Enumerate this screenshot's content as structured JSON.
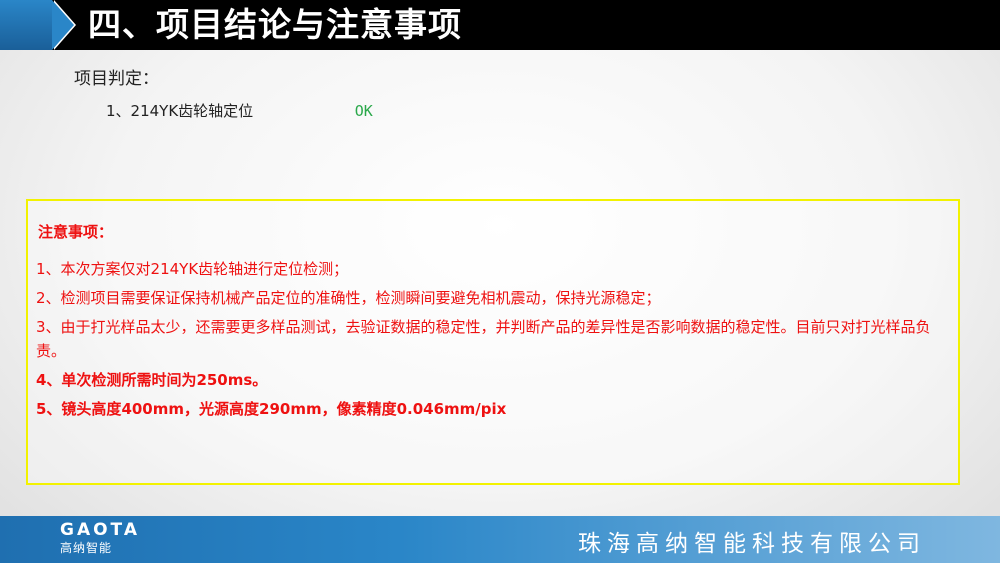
{
  "header": {
    "title": "四、项目结论与注意事项"
  },
  "verdict": {
    "label": "项目判定：",
    "items": [
      {
        "name": "1、214YK齿轮轴定位",
        "result": "OK"
      }
    ]
  },
  "notice": {
    "title": "注意事项：",
    "items": [
      "1、本次方案仅对214YK齿轮轴进行定位检测；",
      "2、检测项目需要保证保持机械产品定位的准确性，检测瞬间要避免相机震动，保持光源稳定；",
      "3、由于打光样品太少，还需要更多样品测试，去验证数据的稳定性，并判断产品的差异性是否影响数据的稳定性。目前只对打光样品负责。",
      "4、单次检测所需时间为250ms。",
      "5、镜头高度400mm，光源高度290mm，像素精度0.046mm/pix"
    ]
  },
  "footer": {
    "logo_en": "GAOTA",
    "logo_cn": "高纳智能",
    "company": "珠海高纳智能科技有限公司"
  },
  "colors": {
    "accent_blue": "#2a86c8",
    "notice_red": "#ee1111",
    "ok_green": "#2aa84a",
    "notice_border": "#f2f200"
  }
}
